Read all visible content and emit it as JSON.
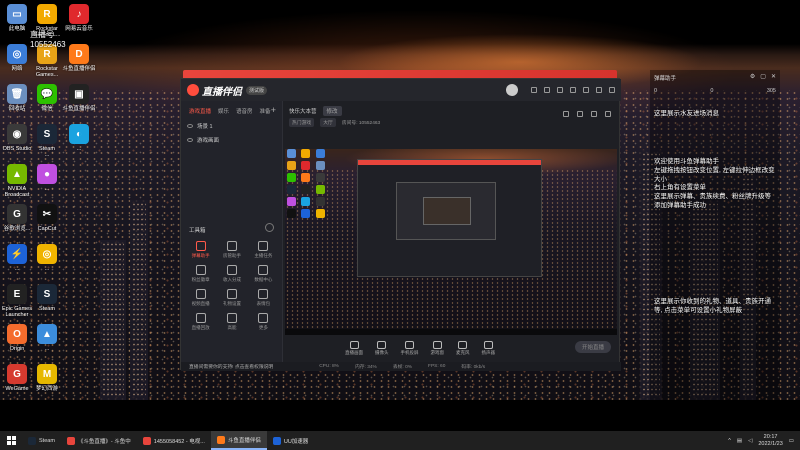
{
  "desktop": {
    "icons": [
      {
        "label": "此电脑",
        "color": "#5a8fd6",
        "glyph": "▭"
      },
      {
        "label": "Rockstar\nGames L...",
        "color": "#f2a900",
        "glyph": "R"
      },
      {
        "label": "网络",
        "color": "#3b7dd8",
        "glyph": "◎"
      },
      {
        "label": "Rockstar\nGames...",
        "color": "#e8a317",
        "glyph": "R"
      },
      {
        "label": "网易云音乐",
        "color": "#e0292d",
        "glyph": "♪"
      },
      {
        "label": "回收站",
        "color": "#6b8fbf",
        "glyph": "🗑"
      },
      {
        "label": "微信",
        "color": "#2dc100",
        "glyph": "💬"
      },
      {
        "label": "斗鱼直播伴侣",
        "color": "#ff7a1a",
        "glyph": "D"
      },
      {
        "label": "OBS Studio",
        "color": "#3a3a3a",
        "glyph": "◉"
      },
      {
        "label": "Steam\n...",
        "color": "#1b2838",
        "glyph": "S"
      },
      {
        "label": "斗鱼直播伴侣",
        "color": "#222",
        "glyph": "▣"
      },
      {
        "label": "NVIDIA\nBroadcast",
        "color": "#76b900",
        "glyph": "▲"
      },
      {
        "label": "...",
        "color": "#c050e0",
        "glyph": "●"
      },
      {
        "label": "...",
        "color": "#1aa3e0",
        "glyph": "◐"
      },
      {
        "label": "谷歌浏览...",
        "color": "#333",
        "glyph": "G"
      },
      {
        "label": "CapCut",
        "color": "#111",
        "glyph": "✂"
      },
      {
        "label": "...",
        "color": "#1d63d8",
        "glyph": "⚡"
      },
      {
        "label": "...",
        "color": "#f0b400",
        "glyph": "◎"
      },
      {
        "label": "Epic Games\nLauncher",
        "color": "#222",
        "glyph": "E"
      },
      {
        "label": "Steam",
        "color": "#1b2838",
        "glyph": "S"
      },
      {
        "label": "Origin",
        "color": "#f56c2d",
        "glyph": "O"
      },
      {
        "label": "...",
        "color": "#3c8ddc",
        "glyph": "▲"
      },
      {
        "label": "WeGame",
        "color": "#d63a2f",
        "glyph": "G"
      },
      {
        "label": "梦幻西游",
        "color": "#e6b800",
        "glyph": "M"
      }
    ],
    "badge_text": "直播号\n10552463"
  },
  "app": {
    "logo_text": "直播伴侣",
    "version_badge": "测试版",
    "left_tabs": [
      "游戏直播",
      "娱乐",
      "语音房",
      "准备"
    ],
    "scenes": [
      "场景 1",
      "游戏画面"
    ],
    "tools_title": "工具箱",
    "tools": [
      {
        "label": "弹幕助手",
        "red": true
      },
      {
        "label": "房管助手",
        "red": false
      },
      {
        "label": "主播任务",
        "red": false
      },
      {
        "label": "粉丝徽章",
        "red": false
      },
      {
        "label": "收入分成",
        "red": false
      },
      {
        "label": "数据中心",
        "red": false
      },
      {
        "label": "视频直播",
        "red": false
      },
      {
        "label": "礼物设置",
        "red": false
      },
      {
        "label": "表情包",
        "red": false
      },
      {
        "label": "直播回放",
        "red": false
      },
      {
        "label": "高能",
        "red": false
      },
      {
        "label": "更多",
        "red": false
      }
    ],
    "room_title": "快乐大本营",
    "room_edit": "修改",
    "room_chips": [
      "热门游戏",
      "大厅",
      "房间号: 10552463"
    ],
    "controls": [
      "直播画面",
      "摄像头",
      "手机投屏",
      "游戏窗",
      "麦克风",
      "扬声器"
    ],
    "go_live_label": "开始直播",
    "status_notice": "直播间需要你的支持! 点击查看权限说明",
    "stats": [
      "CPU: 8%",
      "内存: 34%",
      "丢帧: 0%",
      "FPS: 60",
      "码率: 0kb/s"
    ]
  },
  "assistant": {
    "title": "弹幕助手",
    "counts": [
      "0",
      "0",
      "305"
    ],
    "messages": [
      "这里展示水友进场消息",
      "欢迎使用斗鱼弹幕助手\n左键拖拽按钮改变位置, 左键拉伸边框改变大小\n右上角有设置菜单\n这里展示弹幕、贵族续费、粉丝牌升级等\n添加弹幕助手成功",
      "这里展示你收到的礼物、道具、贵族开通等, 点击菜单可设置小礼物屏蔽"
    ]
  },
  "taskbar": {
    "items": [
      {
        "label": "Steam",
        "color": "#1b2838",
        "active": false
      },
      {
        "label": "《斗鱼直播》- 斗鱼中",
        "color": "#e8453c",
        "active": false
      },
      {
        "label": "1455058452 - 电视...",
        "color": "#e8453c",
        "active": false
      },
      {
        "label": "斗鱼直播伴侣",
        "color": "#ff7a1a",
        "active": true
      },
      {
        "label": "UU加速器",
        "color": "#1d63d8",
        "active": false
      }
    ],
    "time": "20:17",
    "date": "2022/1/23"
  }
}
